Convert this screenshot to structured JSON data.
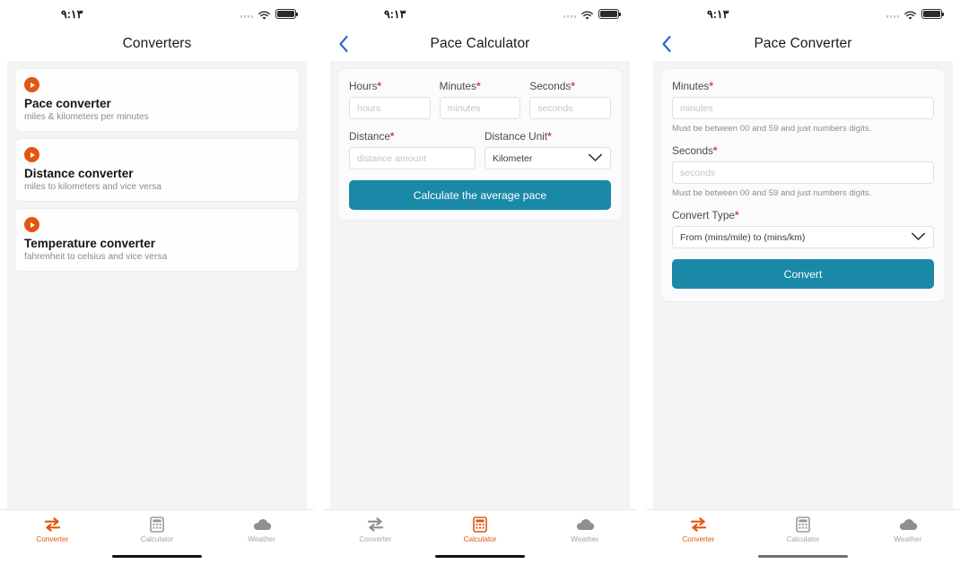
{
  "status_bar": {
    "time": "٩:١٣",
    "signal_icon": "signal-bars-icon",
    "wifi_icon": "wifi-icon",
    "battery_icon": "battery-full-icon"
  },
  "tabs": [
    {
      "label": "Converter",
      "icon": "exchange-arrows-icon"
    },
    {
      "label": "Calculator",
      "icon": "calculator-icon"
    },
    {
      "label": "Weather",
      "icon": "cloud-icon"
    }
  ],
  "colors": {
    "accent_orange": "#e2560f",
    "primary_teal": "#1a89a7",
    "back_blue": "#2a63c4",
    "required_red": "#d0424c",
    "muted_gray": "#8e8e8e"
  },
  "screen1": {
    "title": "Converters",
    "active_tab": "Converter",
    "home_indicator_color": "#111111",
    "items": [
      {
        "icon": "play-circle-icon",
        "title": "Pace converter",
        "subtitle": "miles & kilometers per minutes"
      },
      {
        "icon": "play-circle-icon",
        "title": "Distance converter",
        "subtitle": "miles to kilometers and vice versa"
      },
      {
        "icon": "play-circle-icon",
        "title": "Temperature converter",
        "subtitle": "fahrenheit to celsius and vice versa"
      }
    ]
  },
  "screen2": {
    "title": "Pace Calculator",
    "back_icon": "chevron-left-icon",
    "active_tab": "Calculator",
    "home_indicator_color": "#111111",
    "fields": {
      "hours": {
        "label": "Hours",
        "required": "*",
        "placeholder": "hours",
        "value": ""
      },
      "minutes": {
        "label": "Minutes",
        "required": "*",
        "placeholder": "minutes",
        "value": ""
      },
      "seconds": {
        "label": "Seconds",
        "required": "*",
        "placeholder": "seconds",
        "value": ""
      },
      "distance": {
        "label": "Distance",
        "required": "*",
        "placeholder": "distance amount",
        "value": ""
      },
      "distance_unit": {
        "label": "Distance Unit",
        "required": "*",
        "selected": "Kilometer",
        "chevron": "chevron-down-icon"
      }
    },
    "submit_label": "Calculate the average pace"
  },
  "screen3": {
    "title": "Pace Converter",
    "back_icon": "chevron-left-icon",
    "active_tab": "Converter",
    "home_indicator_color": "#6f6f6f",
    "fields": {
      "minutes": {
        "label": "Minutes",
        "required": "*",
        "placeholder": "minutes",
        "value": "",
        "helper": "Must be between 00 and 59 and just numbers digits."
      },
      "seconds": {
        "label": "Seconds",
        "required": "*",
        "placeholder": "seconds",
        "value": "",
        "helper": "Must be between 00 and 59 and just numbers digits."
      },
      "convert_type": {
        "label": "Convert Type",
        "required": "*",
        "selected": "From (mins/mile) to (mins/km)",
        "chevron": "chevron-down-icon"
      }
    },
    "submit_label": "Convert"
  }
}
